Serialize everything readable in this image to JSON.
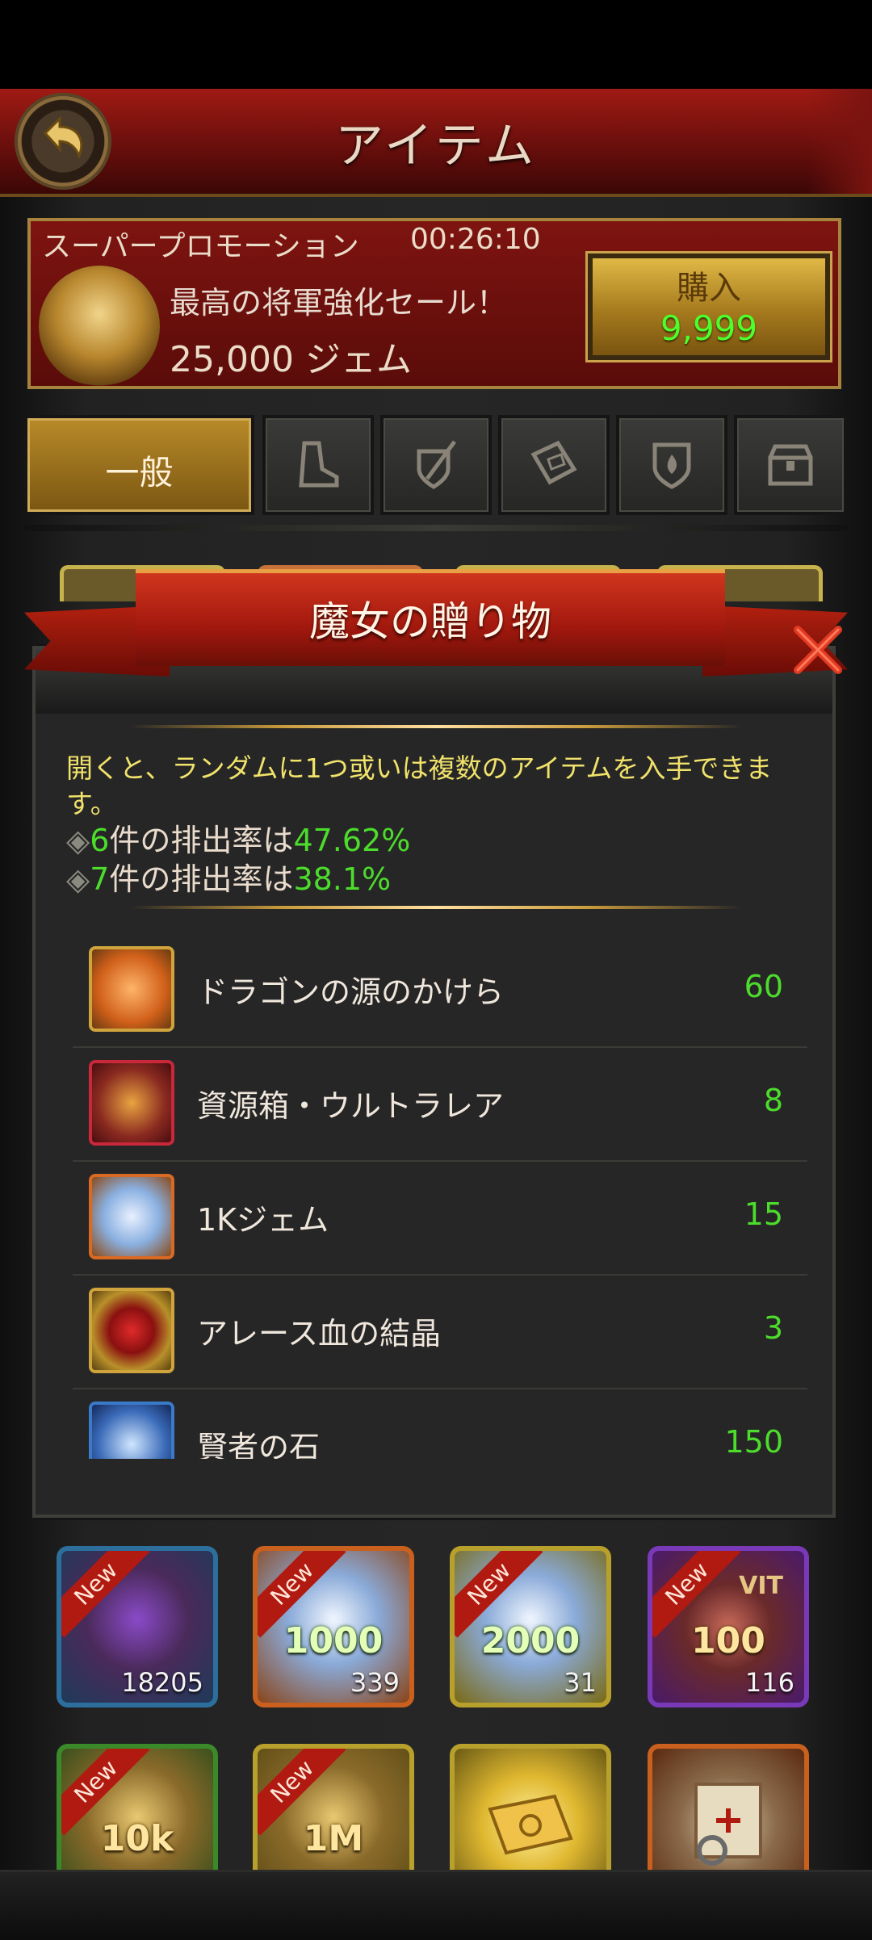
{
  "header": {
    "title": "アイテム"
  },
  "promo": {
    "label": "スーパープロモーション",
    "timer": "00:26:10",
    "headline": "最高の将軍強化セール！",
    "price": "25,000 ジェム",
    "buy_label": "購入",
    "buy_price": "9,999"
  },
  "tabs": [
    {
      "label": "一般",
      "icon": "general"
    },
    {
      "icon": "boot-icon"
    },
    {
      "icon": "sword-shield-icon"
    },
    {
      "icon": "book-icon"
    },
    {
      "icon": "fire-shield-icon"
    },
    {
      "icon": "chest-icon"
    }
  ],
  "modal": {
    "title": "魔女の贈り物",
    "description": "開くと、ランダムに1つ或いは複数のアイテムを入手できます。",
    "rate1": {
      "prefix": "◈",
      "count": "6",
      "text": "件の排出率は",
      "pct": "47.62%"
    },
    "rate2": {
      "prefix": "◈",
      "count": "7",
      "text": "件の排出率は",
      "pct": "38.1%"
    },
    "items": [
      {
        "name": "ドラゴンの源のかけら",
        "qty": "60",
        "icon": "dragon-shard-icon"
      },
      {
        "name": "資源箱・ウルトラレア",
        "qty": "8",
        "icon": "resource-chest-icon"
      },
      {
        "name": "1Kジェム",
        "qty": "15",
        "icon": "gem-1k-icon"
      },
      {
        "name": "アレース血の結晶",
        "qty": "3",
        "icon": "blood-crystal-icon"
      },
      {
        "name": "賢者の石",
        "qty": "150",
        "icon": "sage-stone-icon"
      }
    ]
  },
  "grid": [
    {
      "new": "New",
      "amount": "",
      "count": "18205",
      "icon": "amethyst-chest-icon"
    },
    {
      "new": "New",
      "amount": "1000",
      "count": "339",
      "icon": "gems-icon"
    },
    {
      "new": "New",
      "amount": "2000",
      "count": "31",
      "icon": "gems-icon"
    },
    {
      "new": "New",
      "amount": "100",
      "badge": "VIT",
      "count": "116",
      "icon": "meat-icon"
    },
    {
      "new": "New",
      "amount": "10k",
      "count": "",
      "icon": "gold-chest-icon"
    },
    {
      "new": "New",
      "amount": "1M",
      "count": "",
      "icon": "gold-chest-icon"
    },
    {
      "new": "",
      "amount": "",
      "count": "",
      "icon": "ticket-icon"
    },
    {
      "new": "",
      "amount": "",
      "count": "",
      "icon": "scroll-icon"
    }
  ]
}
